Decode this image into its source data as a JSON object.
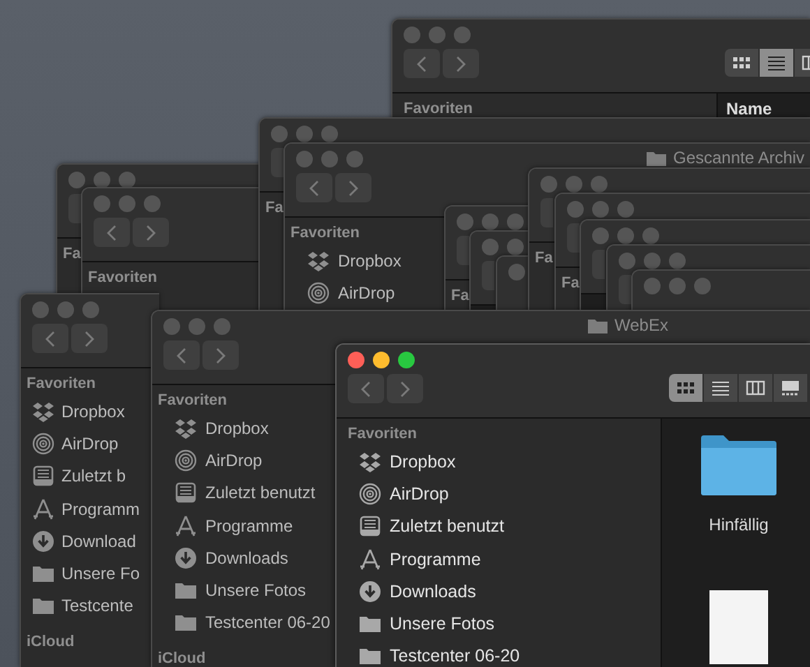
{
  "desktop": {
    "windows": [
      {
        "kind": "finder",
        "view_modes": [
          {
            "kind": "icons",
            "selected": false
          },
          {
            "kind": "list",
            "selected": true
          },
          {
            "kind": "columns",
            "selected": false
          }
        ],
        "sidebar": {
          "heading": "Favoriten"
        },
        "column_header": "Name"
      },
      {
        "kind": "finder",
        "sidebar": {
          "heading": "Fa"
        }
      },
      {
        "kind": "finder",
        "sidebar": {
          "heading": "Favoriten"
        }
      },
      {
        "kind": "finder",
        "sidebar": {
          "heading": "Fa"
        }
      },
      {
        "kind": "finder",
        "title": "Gescannte Archiv",
        "sidebar": {
          "heading": "Favoriten",
          "items": [
            {
              "kind": "dropbox",
              "label": "Dropbox"
            },
            {
              "kind": "airdrop",
              "label": "AirDrop"
            }
          ]
        }
      },
      {
        "kind": "finder",
        "sidebar": {
          "heading": "Fa"
        }
      },
      {
        "kind": "finder"
      },
      {
        "kind": "finder"
      },
      {
        "kind": "finder",
        "sidebar": {
          "heading": "Fa"
        }
      },
      {
        "kind": "finder",
        "sidebar": {
          "heading": "Fa"
        }
      },
      {
        "kind": "finder"
      },
      {
        "kind": "finder"
      },
      {
        "kind": "finder"
      },
      {
        "kind": "finder",
        "sidebar": {
          "heading": "Favoriten",
          "items": [
            {
              "kind": "dropbox",
              "label": "Dropbox"
            },
            {
              "kind": "airdrop",
              "label": "AirDrop"
            },
            {
              "kind": "recents",
              "label": "Zuletzt b"
            },
            {
              "kind": "apps",
              "label": "Programm"
            },
            {
              "kind": "downloads",
              "label": "Download"
            },
            {
              "kind": "folder",
              "label": "Unsere Fo"
            },
            {
              "kind": "folder",
              "label": "Testcente"
            }
          ],
          "section2": "iCloud"
        }
      },
      {
        "kind": "finder",
        "title": "WebEx",
        "sidebar": {
          "heading": "Favoriten",
          "items": [
            {
              "kind": "dropbox",
              "label": "Dropbox"
            },
            {
              "kind": "airdrop",
              "label": "AirDrop"
            },
            {
              "kind": "recents",
              "label": "Zuletzt benutzt"
            },
            {
              "kind": "apps",
              "label": "Programme"
            },
            {
              "kind": "downloads",
              "label": "Downloads"
            },
            {
              "kind": "folder",
              "label": "Unsere Fotos"
            },
            {
              "kind": "folder",
              "label": "Testcenter 06-20"
            }
          ],
          "section2": "iCloud"
        }
      }
    ],
    "front_window": {
      "kind": "finder",
      "active": true,
      "view_modes": [
        {
          "kind": "icons",
          "selected": true
        },
        {
          "kind": "list",
          "selected": false
        },
        {
          "kind": "columns",
          "selected": false
        },
        {
          "kind": "gallery",
          "selected": false
        }
      ],
      "sidebar": {
        "heading": "Favoriten",
        "items": [
          {
            "kind": "dropbox",
            "label": "Dropbox"
          },
          {
            "kind": "airdrop",
            "label": "AirDrop"
          },
          {
            "kind": "recents",
            "label": "Zuletzt benutzt"
          },
          {
            "kind": "apps",
            "label": "Programme"
          },
          {
            "kind": "downloads",
            "label": "Downloads"
          },
          {
            "kind": "folder",
            "label": "Unsere Fotos"
          },
          {
            "kind": "folder",
            "label": "Testcenter 06-20"
          }
        ]
      },
      "files": [
        {
          "kind": "folder",
          "label": "Hinfällig"
        },
        {
          "kind": "document"
        }
      ]
    }
  }
}
